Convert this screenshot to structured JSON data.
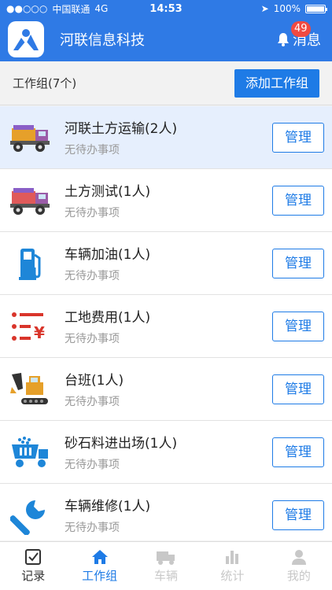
{
  "status": {
    "carrier": "中国联通",
    "network": "4G",
    "time": "14:53",
    "battery": "100%",
    "battery_level": 1.0
  },
  "header": {
    "app_title": "河联信息科技",
    "messages_label": "消息",
    "messages_badge": "49"
  },
  "toolbar": {
    "group_count": "工作组(7个)",
    "add_label": "添加工作组"
  },
  "groups": [
    {
      "title": "河联土方运输(2人)",
      "subtitle": "无待办事项",
      "icon": "dump-truck-icon",
      "selected": true,
      "manage_label": "管理"
    },
    {
      "title": "土方测试(1人)",
      "subtitle": "无待办事项",
      "icon": "dump-truck-icon",
      "selected": false,
      "manage_label": "管理"
    },
    {
      "title": "车辆加油(1人)",
      "subtitle": "无待办事项",
      "icon": "fuel-pump-icon",
      "selected": false,
      "manage_label": "管理"
    },
    {
      "title": "工地费用(1人)",
      "subtitle": "无待办事项",
      "icon": "expense-list-icon",
      "selected": false,
      "manage_label": "管理"
    },
    {
      "title": "台班(1人)",
      "subtitle": "无待办事项",
      "icon": "excavator-icon",
      "selected": false,
      "manage_label": "管理"
    },
    {
      "title": "砂石料进出场(1人)",
      "subtitle": "无待办事项",
      "icon": "gravel-truck-icon",
      "selected": false,
      "manage_label": "管理"
    },
    {
      "title": "车辆维修(1人)",
      "subtitle": "无待办事项",
      "icon": "wrench-icon",
      "selected": false,
      "manage_label": "管理"
    }
  ],
  "tabs": [
    {
      "label": "记录",
      "icon": "checklist-icon",
      "state": "normal"
    },
    {
      "label": "工作组",
      "icon": "home-icon",
      "state": "active"
    },
    {
      "label": "车辆",
      "icon": "truck-icon",
      "state": "disabled"
    },
    {
      "label": "统计",
      "icon": "bar-chart-icon",
      "state": "disabled"
    },
    {
      "label": "我的",
      "icon": "user-icon",
      "state": "disabled"
    }
  ],
  "colors": {
    "primary": "#2f7ae5",
    "button": "#1e7be6",
    "badge": "#f04a42",
    "selected_row": "#e6effd"
  }
}
